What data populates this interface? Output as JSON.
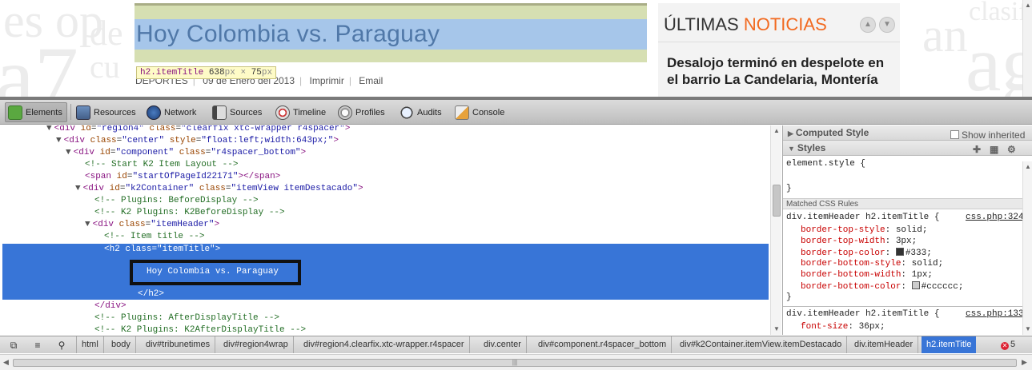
{
  "page": {
    "article_title": "Hoy Colombia vs. Paraguay",
    "meta": {
      "category": "DEPORTES",
      "date": "09 de Enero del 2013",
      "print_link": "Imprimir",
      "email_link": "Email"
    },
    "tooltip": {
      "selector": "h2.itemTitle",
      "width": "638",
      "height": "75",
      "unit": "px",
      "times": "×"
    },
    "news": {
      "heading_part1": "ÚLTIMAS",
      "heading_part2": "NOTICIAS",
      "story": "Desalojo terminó en despelote en el barrio La Candelaria, Montería",
      "accent_color": "#f26a20"
    },
    "background_words": [
      "es op",
      "a7",
      "cu",
      "de",
      "clasif",
      "an",
      "ag"
    ]
  },
  "toolbar": {
    "tabs": [
      {
        "label": "Elements",
        "icon": "elements-icon",
        "active": true
      },
      {
        "label": "Resources",
        "icon": "resources-icon"
      },
      {
        "label": "Network",
        "icon": "network-icon"
      },
      {
        "label": "Sources",
        "icon": "sources-icon"
      },
      {
        "label": "Timeline",
        "icon": "timeline-icon"
      },
      {
        "label": "Profiles",
        "icon": "profiles-icon"
      },
      {
        "label": "Audits",
        "icon": "audits-icon"
      },
      {
        "label": "Console",
        "icon": "console-icon"
      }
    ]
  },
  "dom": {
    "l1": {
      "tag": "div",
      "a1": "id",
      "v1": "\"region4\"",
      "a2": "class",
      "v2": "\"clearfix xtc-wrapper r4spacer\""
    },
    "l2": {
      "tag": "div",
      "a1": "class",
      "v1": "\"center\"",
      "a2": "style",
      "v2": "\"float:left;width:643px;\""
    },
    "l3": {
      "tag": "div",
      "a1": "id",
      "v1": "\"component\"",
      "a2": "class",
      "v2": "\"r4spacer_bottom\""
    },
    "l4": "<!-- Start K2 Item Layout -->",
    "l5": {
      "tag": "span",
      "a1": "id",
      "v1": "\"startOfPageId22171\"",
      "close": "</span>"
    },
    "l6": {
      "tag": "div",
      "a1": "id",
      "v1": "\"k2Container\"",
      "a2": "class",
      "v2": "\"itemView itemDestacado\""
    },
    "l7": "<!-- Plugins: BeforeDisplay -->",
    "l8": "<!-- K2 Plugins: K2BeforeDisplay -->",
    "l9": {
      "tag": "div",
      "a1": "class",
      "v1": "\"itemHeader\""
    },
    "l10": "<!-- Item title -->",
    "l11": {
      "tag": "h2",
      "a1": "class",
      "v1": "\"itemTitle\""
    },
    "l12": "Hoy Colombia vs. Paraguay",
    "l13": "</h2>",
    "l14": "</div>",
    "l15": "<!-- Plugins: AfterDisplayTitle -->",
    "l16": "<!-- K2 Plugins: K2AfterDisplayTitle -->"
  },
  "styles": {
    "computed_style": "Computed Style",
    "show_inherited": "Show inherited",
    "styles_label": "Styles",
    "element_style": "element.style {",
    "close_brace": "}",
    "matched_rules": "Matched CSS Rules",
    "rule1": {
      "selector": "div.itemHeader h2.itemTitle {",
      "source": "css.php:324",
      "props": [
        {
          "name": "border-top-style",
          "value": "solid;"
        },
        {
          "name": "border-top-width",
          "value": "3px;"
        },
        {
          "name": "border-top-color",
          "value": "#333;",
          "swatch": "#333333"
        },
        {
          "name": "border-bottom-style",
          "value": "solid;"
        },
        {
          "name": "border-bottom-width",
          "value": "1px;"
        },
        {
          "name": "border-bottom-color",
          "value": "#cccccc;",
          "swatch": "#cccccc"
        }
      ]
    },
    "rule2": {
      "selector": "div.itemHeader h2.itemTitle {",
      "source": "css.php:133",
      "props": [
        {
          "name": "font-size",
          "value": "36px;"
        }
      ]
    }
  },
  "breadcrumbs": [
    "html",
    "body",
    "div#tribunetimes",
    "div#region4wrap",
    "div#region4.clearfix.xtc-wrapper.r4spacer",
    "div.center",
    "div#component.r4spacer_bottom",
    "div#k2Container.itemView.itemDestacado",
    "div.itemHeader",
    "h2.itemTitle"
  ],
  "status": {
    "error_count": "5",
    "selected_crumb": "h2.itemTitle"
  },
  "colors": {
    "selection": "#3875d7",
    "title_highlight": "#a6c6ea",
    "title_padding": "#d6dfb2"
  }
}
